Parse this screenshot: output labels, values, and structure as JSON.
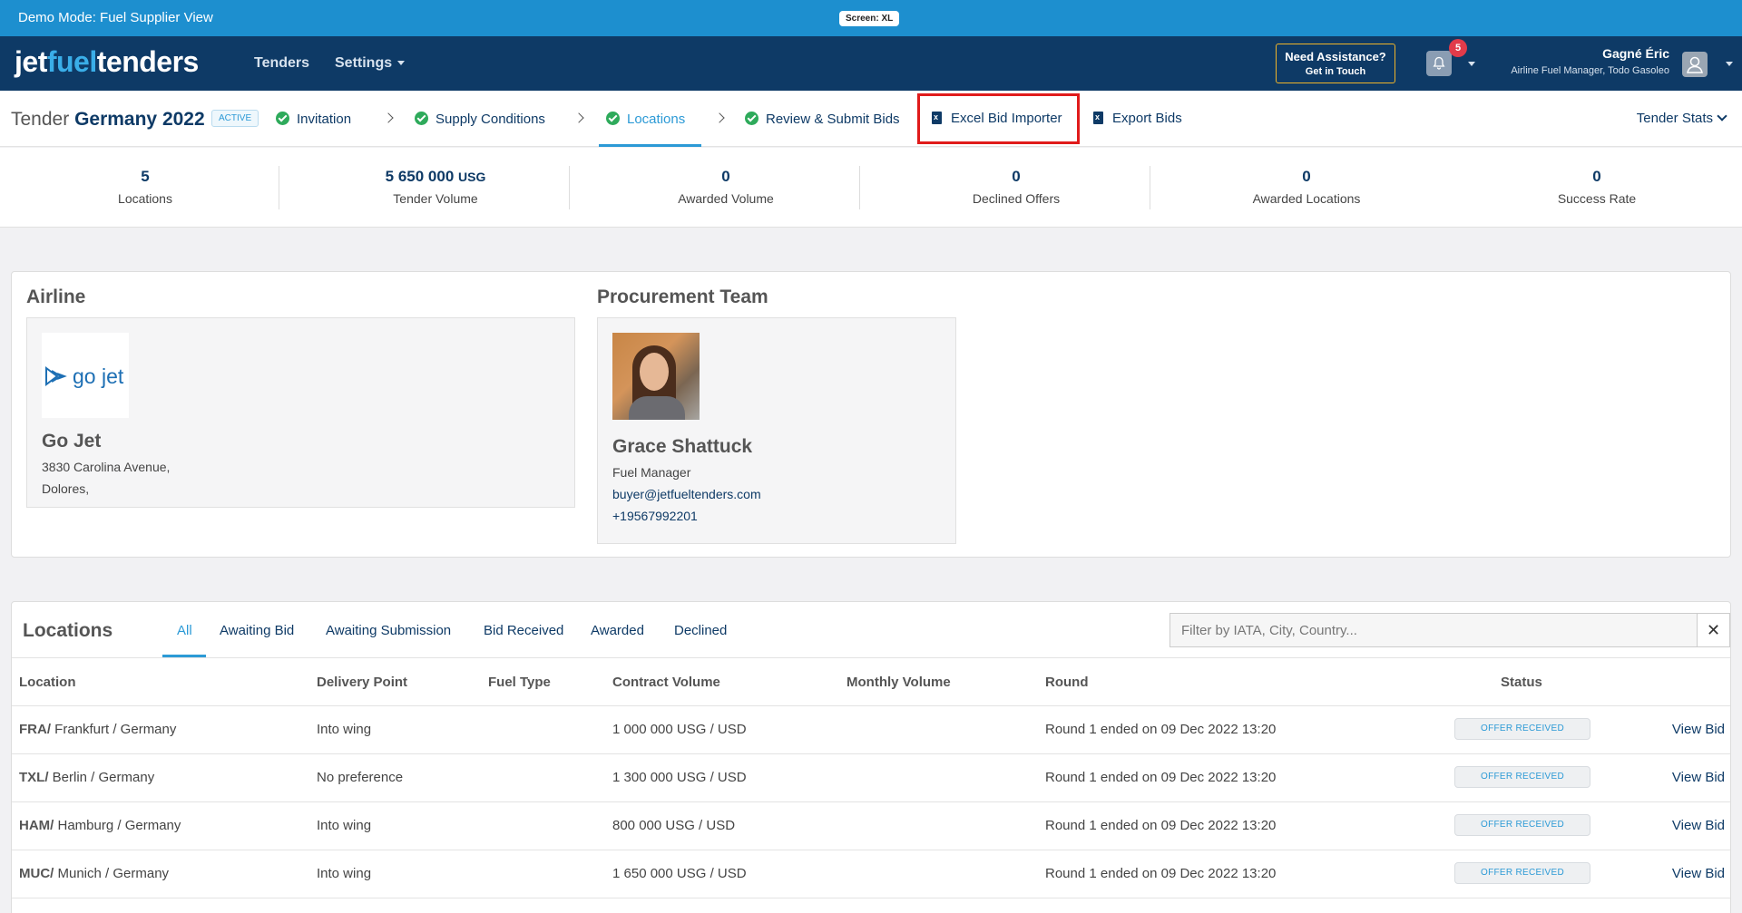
{
  "demo_bar": {
    "title": "Demo Mode: Fuel Supplier View",
    "screen_badge": "Screen: XL"
  },
  "navbar": {
    "logo_part1": "jet",
    "logo_part2": "fuel",
    "logo_part3": "tenders",
    "links": [
      "Tenders",
      "Settings"
    ],
    "assist_line1": "Need Assistance?",
    "assist_line2": "Get in Touch",
    "notification_count": "5",
    "user_name": "Gagné Éric",
    "user_role": "Airline Fuel Manager, Todo Gasoleo"
  },
  "tender": {
    "title_prefix": "Tender",
    "title_name": "Germany 2022",
    "status": "ACTIVE",
    "steps": [
      "Invitation",
      "Supply Conditions",
      "Locations",
      "Review & Submit Bids"
    ],
    "tools": [
      "Excel Bid Importer",
      "Export Bids"
    ],
    "stats_link": "Tender Stats"
  },
  "stats": [
    {
      "value": "5",
      "unit": "",
      "label": "Locations"
    },
    {
      "value": "5 650 000",
      "unit": "USG",
      "label": "Tender Volume"
    },
    {
      "value": "0",
      "unit": "",
      "label": "Awarded Volume"
    },
    {
      "value": "0",
      "unit": "",
      "label": "Declined Offers"
    },
    {
      "value": "0",
      "unit": "",
      "label": "Awarded Locations"
    },
    {
      "value": "0",
      "unit": "",
      "label": "Success Rate"
    }
  ],
  "airline": {
    "section_title": "Airline",
    "logo_text": "go jet",
    "name": "Go Jet",
    "address_line1": "3830 Carolina Avenue,",
    "address_line2": "Dolores,"
  },
  "procurement": {
    "section_title": "Procurement Team",
    "name": "Grace Shattuck",
    "role": "Fuel Manager",
    "email": "buyer@jetfueltenders.com",
    "phone": "+19567992201"
  },
  "locations": {
    "title": "Locations",
    "tabs": [
      "All",
      "Awaiting Bid",
      "Awaiting Submission",
      "Bid Received",
      "Awarded",
      "Declined"
    ],
    "filter_placeholder": "Filter by IATA, City, Country...",
    "clear_label": "✕",
    "headers": [
      "Location",
      "Delivery Point",
      "Fuel Type",
      "Contract Volume",
      "Monthly Volume",
      "Round",
      "Status"
    ],
    "rows": [
      {
        "code": "FRA/",
        "place": " Frankfurt / Germany",
        "delivery": "Into wing",
        "volume": "1 000 000 USG / USD",
        "round": "Round 1 ended on 09 Dec 2022 13:20",
        "status": "OFFER RECEIVED",
        "action": "View Bid"
      },
      {
        "code": "TXL/",
        "place": " Berlin / Germany",
        "delivery": "No preference",
        "volume": "1 300 000 USG / USD",
        "round": "Round 1 ended on 09 Dec 2022 13:20",
        "status": "OFFER RECEIVED",
        "action": "View Bid"
      },
      {
        "code": "HAM/",
        "place": " Hamburg / Germany",
        "delivery": "Into wing",
        "volume": "800 000 USG / USD",
        "round": "Round 1 ended on 09 Dec 2022 13:20",
        "status": "OFFER RECEIVED",
        "action": "View Bid"
      },
      {
        "code": "MUC/",
        "place": " Munich / Germany",
        "delivery": "Into wing",
        "volume": "1 650 000 USG / USD",
        "round": "Round 1 ended on 09 Dec 2022 13:20",
        "status": "OFFER RECEIVED",
        "action": "View Bid"
      }
    ]
  }
}
